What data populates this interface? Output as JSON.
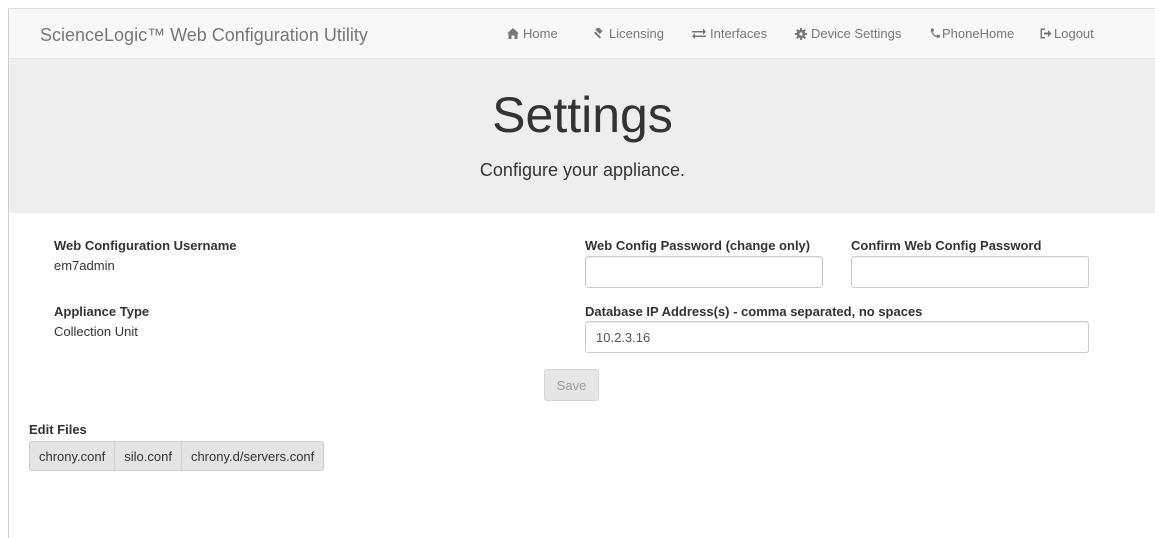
{
  "navbar": {
    "brand": "ScienceLogic™ Web Configuration Utility",
    "items": [
      {
        "label": "Home",
        "icon": "home-icon"
      },
      {
        "label": "Licensing",
        "icon": "gavel-icon"
      },
      {
        "label": "Interfaces",
        "icon": "exchange-icon"
      },
      {
        "label": "Device Settings",
        "icon": "gear-icon"
      },
      {
        "label": "PhoneHome",
        "icon": "phone-icon"
      },
      {
        "label": "Logout",
        "icon": "logout-icon"
      }
    ]
  },
  "header": {
    "title": "Settings",
    "subtitle": "Configure your appliance."
  },
  "settings": {
    "username_label": "Web Configuration Username",
    "username_value": "em7admin",
    "appliance_type_label": "Appliance Type",
    "appliance_type_value": "Collection Unit",
    "password_label": "Web Config Password (change only)",
    "password_value": "",
    "confirm_password_label": "Confirm Web Config Password",
    "confirm_password_value": "",
    "db_ip_label": "Database IP Address(s) - comma separated, no spaces",
    "db_ip_value": "10.2.3.16",
    "save_label": "Save"
  },
  "edit_files": {
    "heading": "Edit Files",
    "files": [
      "chrony.conf",
      "silo.conf",
      "chrony.d/servers.conf"
    ]
  },
  "colors": {
    "navbar_bg": "#f8f8f8",
    "jumbotron_bg": "#eeeeee",
    "nav_text": "#777777"
  }
}
